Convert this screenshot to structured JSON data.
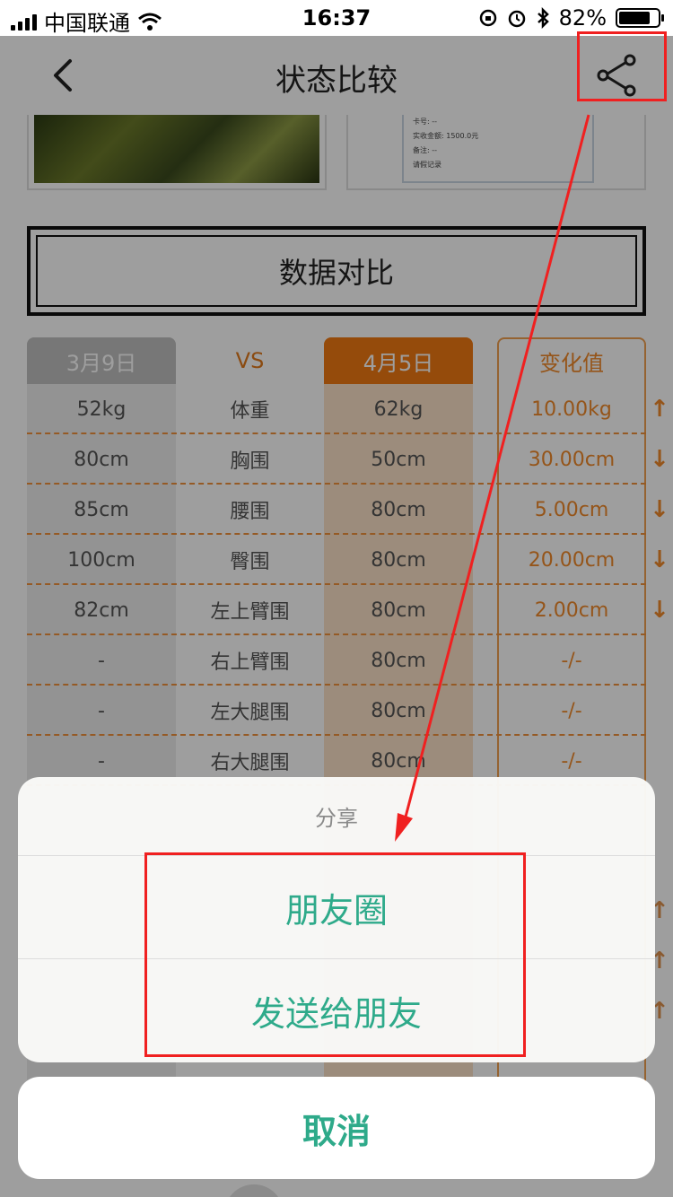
{
  "status_bar": {
    "carrier": "中国联通",
    "time": "16:37",
    "battery": "82%",
    "battery_level": 0.82
  },
  "nav": {
    "title": "状态比较"
  },
  "receipt": {
    "lines": [
      "卡号: --",
      "实收金额: 1500.0元",
      "备注: --",
      "请假记录"
    ]
  },
  "compare_title": "数据对比",
  "table": {
    "headers": {
      "date_a": "3月9日",
      "vs": "VS",
      "date_b": "4月5日",
      "change": "变化值"
    },
    "rows": [
      {
        "a": "52kg",
        "metric": "体重",
        "b": "62kg",
        "change": "10.00kg",
        "arrow": "↑"
      },
      {
        "a": "80cm",
        "metric": "胸围",
        "b": "50cm",
        "change": "30.00cm",
        "arrow": "↓"
      },
      {
        "a": "85cm",
        "metric": "腰围",
        "b": "80cm",
        "change": "5.00cm",
        "arrow": "↓"
      },
      {
        "a": "100cm",
        "metric": "臀围",
        "b": "80cm",
        "change": "20.00cm",
        "arrow": "↓"
      },
      {
        "a": "82cm",
        "metric": "左上臂围",
        "b": "80cm",
        "change": "2.00cm",
        "arrow": "↓"
      },
      {
        "a": "-",
        "metric": "右上臂围",
        "b": "80cm",
        "change": "-/-",
        "arrow": ""
      },
      {
        "a": "-",
        "metric": "左大腿围",
        "b": "80cm",
        "change": "-/-",
        "arrow": ""
      },
      {
        "a": "-",
        "metric": "右大腿围",
        "b": "80cm",
        "change": "-/-",
        "arrow": ""
      }
    ],
    "hidden_arrows": [
      "↑",
      "↑",
      "↑"
    ]
  },
  "share_sheet": {
    "title": "分享",
    "moments": "朋友圈",
    "send_friend": "发送给朋友",
    "cancel": "取消"
  },
  "colors": {
    "accent_orange": "#f07a13",
    "sheet_text": "#2eaa8a",
    "highlight_red": "#f02020"
  }
}
